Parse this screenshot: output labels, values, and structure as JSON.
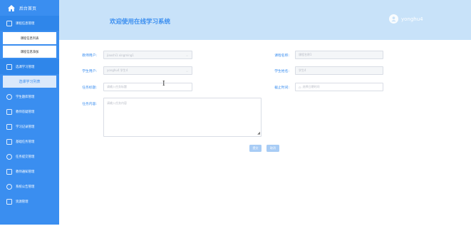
{
  "sidebar": {
    "brand": "后台首页",
    "items": [
      {
        "label": "课程信息管理",
        "active": true,
        "subitems": [
          {
            "label": "课程信息列表"
          },
          {
            "label": "课程信息添加"
          }
        ]
      },
      {
        "label": "选课学习管理",
        "active": true,
        "subitems": [
          {
            "label": "选课学习列表",
            "selected": true
          }
        ]
      },
      {
        "label": "学生题库管理"
      },
      {
        "label": "教师答疑管理"
      },
      {
        "label": "学习记录管理"
      },
      {
        "label": "基础任务管理"
      },
      {
        "label": "任务提交管理"
      },
      {
        "label": "教师通知管理"
      },
      {
        "label": "系统公告管理"
      },
      {
        "label": "资源管理"
      }
    ]
  },
  "header": {
    "title": "欢迎使用在线学习系统",
    "username": "yonghu4"
  },
  "form": {
    "teacher_label": "教师用户:",
    "teacher_value": "jiaoshi1 xingming1",
    "course_label": "课程名称:",
    "course_value": "课程名称1",
    "student_label": "学生用户:",
    "student_value": "yonghu4 学生4",
    "student_name_label": "学生姓名:",
    "student_name_value": "学生4",
    "task_title_label": "任务标题:",
    "task_title_placeholder": "请输入任务标题",
    "deadline_label": "截止时间:",
    "deadline_placeholder": "选择日期时间",
    "content_label": "任务内容:",
    "content_placeholder": "请输入任务内容",
    "submit_label": "提交",
    "cancel_label": "取消"
  }
}
